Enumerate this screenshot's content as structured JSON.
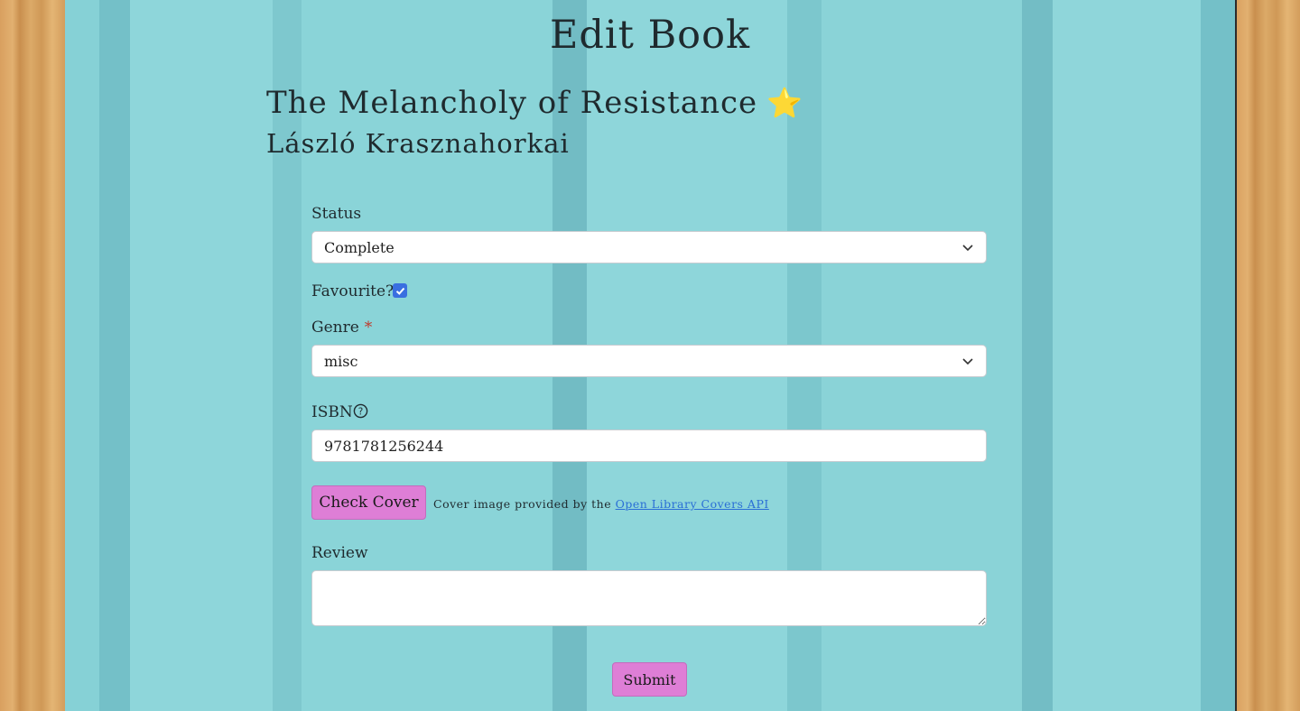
{
  "page": {
    "title": "Edit Book"
  },
  "book": {
    "title": "The Melancholy of Resistance",
    "favourite_icon": "⭐",
    "author": "László Krasznahorkai"
  },
  "form": {
    "status": {
      "label": "Status",
      "value": "Complete"
    },
    "favourite": {
      "label": "Favourite?",
      "checked": true
    },
    "genre": {
      "label": "Genre",
      "required_mark": "*",
      "value": "misc"
    },
    "isbn": {
      "label": "ISBN",
      "value": "9781781256244"
    },
    "check_cover": {
      "button_label": "Check Cover",
      "note": "Cover image provided by the",
      "link_text": "Open Library Covers API"
    },
    "review": {
      "label": "Review",
      "value": ""
    },
    "submit_label": "Submit"
  },
  "colors": {
    "button": "#de7ed6",
    "checkbox": "#3a6fe0",
    "link": "#2a6fd6",
    "panel": "#8ed6da",
    "wood": "#d9a05f"
  }
}
